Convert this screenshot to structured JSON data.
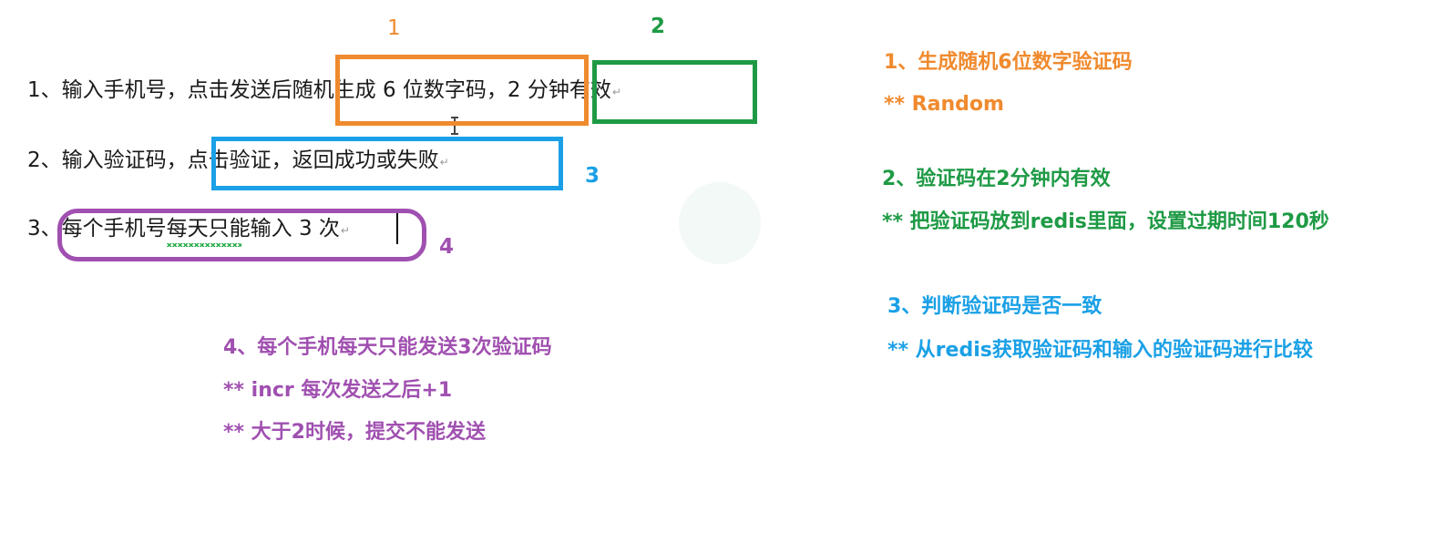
{
  "requirements": [
    {
      "text": "1、输入手机号，点击发送后随机生成 6 位数字码，2 分钟有效"
    },
    {
      "text": "2、输入验证码，点击验证，返回成功或失败"
    },
    {
      "text": "3、每个手机号每天只能输入 3 次"
    }
  ],
  "markers": [
    "1",
    "2",
    "3",
    "4"
  ],
  "return_symbol": "↵",
  "notes": {
    "n1": {
      "title": "1、生成随机6位数字验证码",
      "detail": "** Random"
    },
    "n2": {
      "title": "2、验证码在2分钟内有效",
      "detail": "** 把验证码放到redis里面，设置过期时间120秒"
    },
    "n3": {
      "title": "3、判断验证码是否一致",
      "detail": "** 从redis获取验证码和输入的验证码进行比较"
    },
    "n4": {
      "title": "4、每个手机每天只能发送3次验证码",
      "detail1": "** incr 每次发送之后+1",
      "detail2": "** 大于2时候，提交不能发送"
    }
  },
  "colors": {
    "orange": "#f08a2e",
    "green": "#1e9a45",
    "blue": "#1aa0e6",
    "purple": "#a050b0"
  }
}
